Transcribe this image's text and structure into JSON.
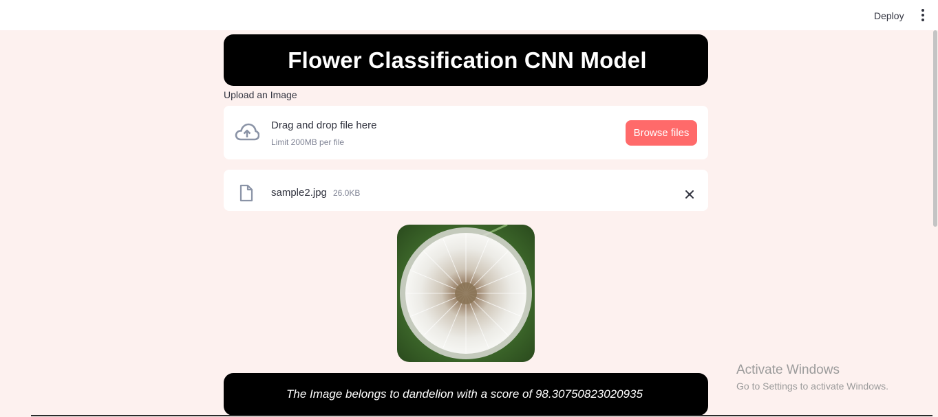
{
  "header": {
    "deploy_label": "Deploy",
    "menu_icon": "kebab-menu-icon"
  },
  "main": {
    "title": "Flower Classification CNN Model",
    "uploader": {
      "label": "Upload an Image",
      "icon": "cloud-upload-icon",
      "drag_text": "Drag and drop file here",
      "limit_text": "Limit 200MB per file",
      "browse_label": "Browse files"
    },
    "uploaded_file": {
      "icon": "file-icon",
      "name": "sample2.jpg",
      "size": "26.0KB",
      "remove_icon": "close-icon"
    },
    "result_text": "The Image belongs to dandelion with a score of 98.30750823020935"
  },
  "os_overlay": {
    "title": "Activate Windows",
    "subtitle": "Go to Settings to activate Windows."
  },
  "colors": {
    "page_bg": "#fdf1ef",
    "accent": "#ff6a6a",
    "banner_bg": "#000000"
  }
}
